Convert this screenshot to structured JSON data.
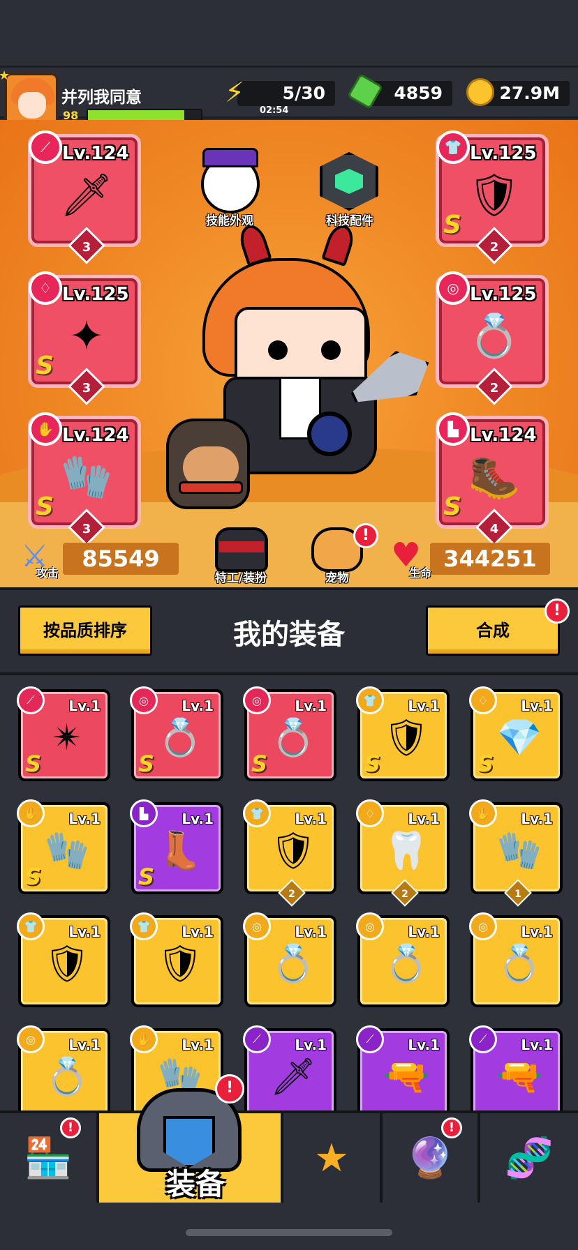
{
  "player": {
    "name": "并列我同意",
    "level": "98",
    "xp_fraction": 0.85
  },
  "resources": {
    "energy": "5/30",
    "energy_timer": "02:54",
    "gems": "4859",
    "gold": "27.9M"
  },
  "hero_icons": {
    "skill_skin": "技能外观",
    "tech_parts": "科技配件",
    "agent_outfit": "特工/装扮",
    "pet": "宠物"
  },
  "equipped_left": [
    {
      "level": "Lv.124",
      "grade": "",
      "stars": "3",
      "category": "weapon-icon",
      "art": "kunai"
    },
    {
      "level": "Lv.125",
      "grade": "S",
      "stars": "3",
      "category": "necklace-icon",
      "art": "necklace"
    },
    {
      "level": "Lv.124",
      "grade": "S",
      "stars": "3",
      "category": "glove-icon",
      "art": "glove"
    }
  ],
  "equipped_right": [
    {
      "level": "Lv.125",
      "grade": "S",
      "stars": "2",
      "category": "armor-icon",
      "art": "armor"
    },
    {
      "level": "Lv.125",
      "grade": "",
      "stars": "2",
      "category": "belt-icon",
      "art": "belt"
    },
    {
      "level": "Lv.124",
      "grade": "S",
      "stars": "4",
      "category": "boots-icon",
      "art": "boots"
    }
  ],
  "stats": {
    "attack_label": "攻击",
    "attack": "85549",
    "hp_label": "生命",
    "hp": "344251"
  },
  "inventory_header": {
    "sort_button": "按品质排序",
    "title": "我的装备",
    "merge_button": "合成",
    "merge_badge": "!"
  },
  "inventory": [
    {
      "color": "red",
      "level": "Lv.1",
      "grade": "S",
      "stars": "",
      "category": "weapon",
      "art": "shuriken"
    },
    {
      "color": "red",
      "level": "Lv.1",
      "grade": "S",
      "stars": "",
      "category": "belt",
      "art": "belt"
    },
    {
      "color": "red",
      "level": "Lv.1",
      "grade": "S",
      "stars": "",
      "category": "belt",
      "art": "belt"
    },
    {
      "color": "yellow",
      "level": "Lv.1",
      "grade": "S",
      "stars": "",
      "category": "armor",
      "art": "armor"
    },
    {
      "color": "yellow",
      "level": "Lv.1",
      "grade": "S",
      "stars": "",
      "category": "necklace",
      "art": "necklace"
    },
    {
      "color": "yellow",
      "level": "Lv.1",
      "grade": "S",
      "stars": "",
      "category": "glove",
      "art": "glove"
    },
    {
      "color": "purple",
      "level": "Lv.1",
      "grade": "S",
      "stars": "",
      "category": "boots",
      "art": "boots"
    },
    {
      "color": "yellow",
      "level": "Lv.1",
      "grade": "",
      "stars": "2",
      "category": "armor",
      "art": "armor"
    },
    {
      "color": "yellow",
      "level": "Lv.1",
      "grade": "",
      "stars": "2",
      "category": "necklace",
      "art": "fang-necklace"
    },
    {
      "color": "yellow",
      "level": "Lv.1",
      "grade": "",
      "stars": "1",
      "category": "glove",
      "art": "glove"
    },
    {
      "color": "yellow",
      "level": "Lv.1",
      "grade": "",
      "stars": "",
      "category": "armor",
      "art": "armor"
    },
    {
      "color": "yellow",
      "level": "Lv.1",
      "grade": "",
      "stars": "",
      "category": "armor",
      "art": "armor"
    },
    {
      "color": "yellow",
      "level": "Lv.1",
      "grade": "",
      "stars": "",
      "category": "belt",
      "art": "belt"
    },
    {
      "color": "yellow",
      "level": "Lv.1",
      "grade": "",
      "stars": "",
      "category": "belt",
      "art": "belt"
    },
    {
      "color": "yellow",
      "level": "Lv.1",
      "grade": "",
      "stars": "",
      "category": "belt",
      "art": "belt"
    },
    {
      "color": "yellow",
      "level": "Lv.1",
      "grade": "",
      "stars": "",
      "category": "belt",
      "art": "belt"
    },
    {
      "color": "yellow",
      "level": "Lv.1",
      "grade": "",
      "stars": "",
      "category": "glove",
      "art": "glove"
    },
    {
      "color": "purple",
      "level": "Lv.1",
      "grade": "",
      "stars": "",
      "category": "weapon",
      "art": "kunai"
    },
    {
      "color": "purple",
      "level": "Lv.1",
      "grade": "",
      "stars": "",
      "category": "weapon",
      "art": "shotgun"
    },
    {
      "color": "purple",
      "level": "Lv.1",
      "grade": "",
      "stars": "",
      "category": "weapon",
      "art": "shotgun"
    }
  ],
  "nav": {
    "shop_badge": "!",
    "equipment_label": "装备",
    "equipment_badge": "!",
    "gacha_badge": "!"
  },
  "colors": {
    "orange_bg": "#f08a26",
    "red_card": "#ec4961",
    "yellow_card": "#fbc42f",
    "purple_card": "#a23be0",
    "accent": "#fbc93b"
  }
}
